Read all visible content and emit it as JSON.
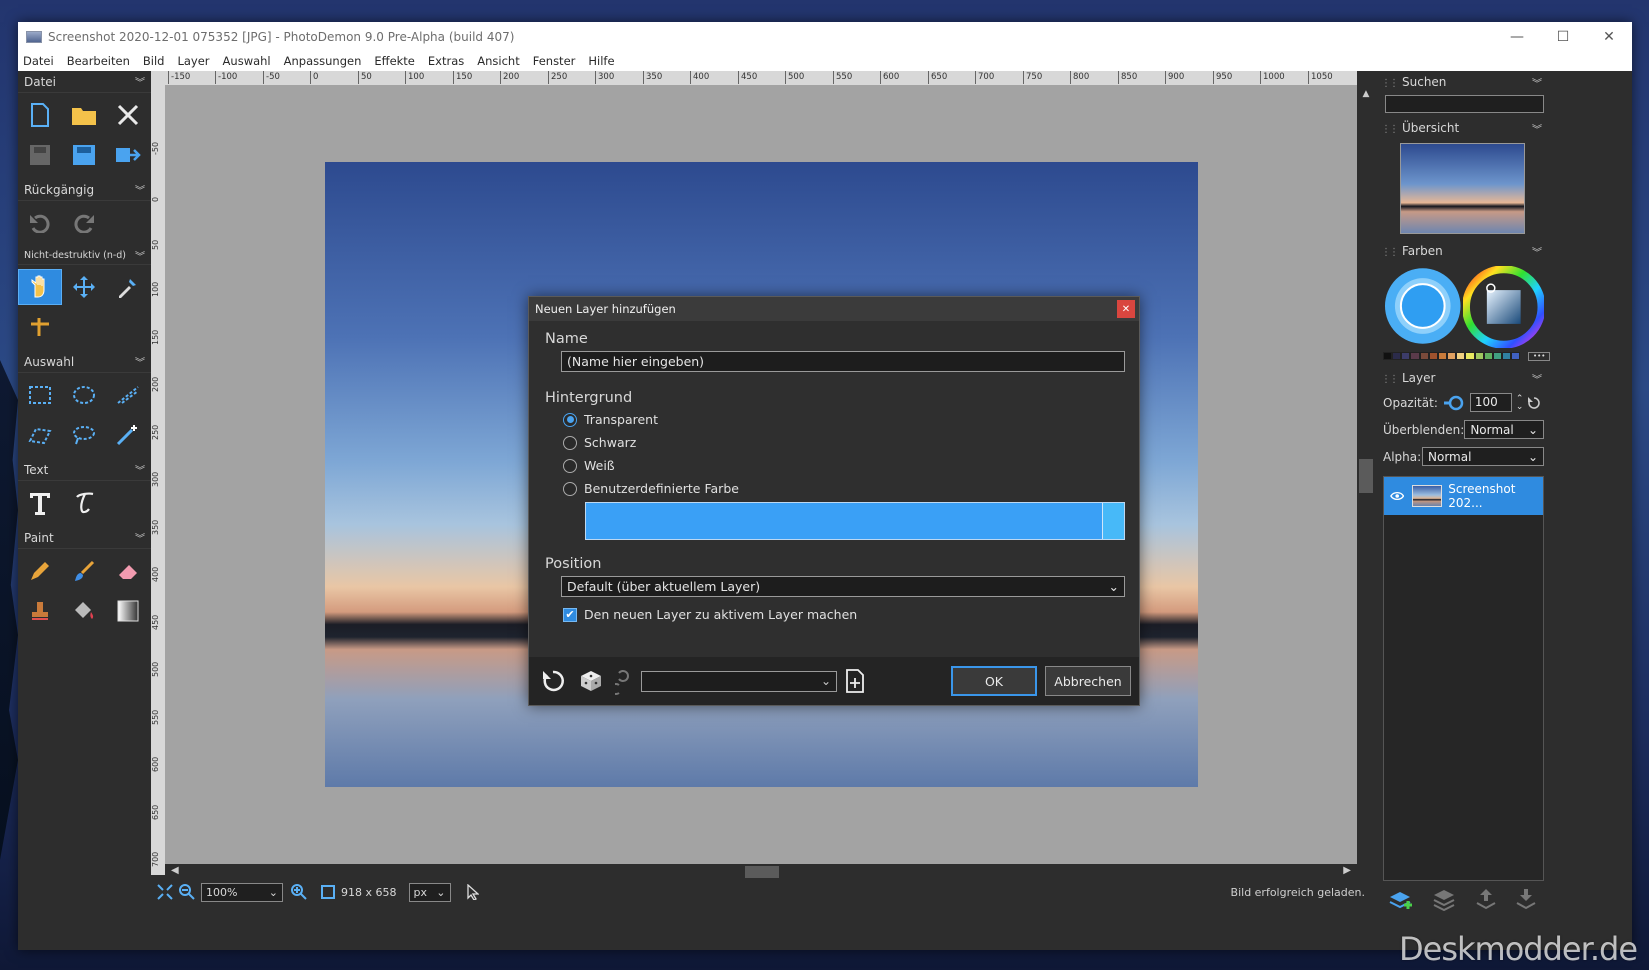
{
  "window": {
    "title": "Screenshot 2020-12-01 075352 [JPG]  -  PhotoDemon 9.0 Pre-Alpha (build 407)",
    "controls": [
      "—",
      "☐",
      "✕"
    ]
  },
  "menu": [
    "Datei",
    "Bearbeiten",
    "Bild",
    "Layer",
    "Auswahl",
    "Anpassungen",
    "Effekte",
    "Extras",
    "Ansicht",
    "Fenster",
    "Hilfe"
  ],
  "left_panel": {
    "sections": {
      "file": "Datei",
      "undo": "Rückgängig",
      "nondestructive": "Nicht-destruktiv (n-d)",
      "selection": "Auswahl",
      "text": "Text",
      "paint": "Paint"
    }
  },
  "ruler": {
    "top": [
      "-150",
      "-100",
      "-50",
      "0",
      "50",
      "100",
      "150",
      "200",
      "250",
      "300",
      "350",
      "400",
      "450",
      "500",
      "550",
      "600",
      "650",
      "700",
      "750",
      "800",
      "850",
      "900",
      "950",
      "1000",
      "1050"
    ],
    "left": [
      "-50",
      "0",
      "50",
      "100",
      "150",
      "200",
      "250",
      "300",
      "350",
      "400",
      "450",
      "500",
      "550",
      "600",
      "650",
      "700"
    ]
  },
  "status": {
    "zoom": "100%",
    "size": "918 x 658",
    "unit": "px",
    "message": "Bild erfolgreich geladen."
  },
  "right_panel": {
    "search_label": "Suchen",
    "overview_label": "Übersicht",
    "colors_label": "Farben",
    "palette": [
      "#111111",
      "#2b2b4a",
      "#3c3c6a",
      "#5a3a4a",
      "#7a4a3a",
      "#a0522d",
      "#c87a3a",
      "#e0a060",
      "#f0d080",
      "#e8e860",
      "#a0c860",
      "#60b060",
      "#40a080",
      "#3080a0",
      "#4060c0"
    ],
    "layer_label": "Layer",
    "opacity_label": "Opazität:",
    "opacity_value": "100",
    "blend_label": "Überblenden:",
    "blend_value": "Normal",
    "alpha_label": "Alpha:",
    "alpha_value": "Normal",
    "layer_name": "Screenshot 202..."
  },
  "dialog": {
    "title": "Neuen Layer hinzufügen",
    "name_label": "Name",
    "name_value": "(Name hier eingeben)",
    "background_label": "Hintergrund",
    "options": [
      "Transparent",
      "Schwarz",
      "Weiß",
      "Benutzerdefinierte Farbe"
    ],
    "selected_option": "Transparent",
    "custom_color": "#3aa0f6",
    "position_label": "Position",
    "position_value": "Default (über aktuellem Layer)",
    "make_active_label": "Den neuen Layer zu aktivem Layer machen",
    "make_active_checked": true,
    "ok": "OK",
    "cancel": "Abbrechen"
  },
  "watermark": "Deskmodder.de",
  "colors": {
    "accent": "#2f8be0"
  }
}
